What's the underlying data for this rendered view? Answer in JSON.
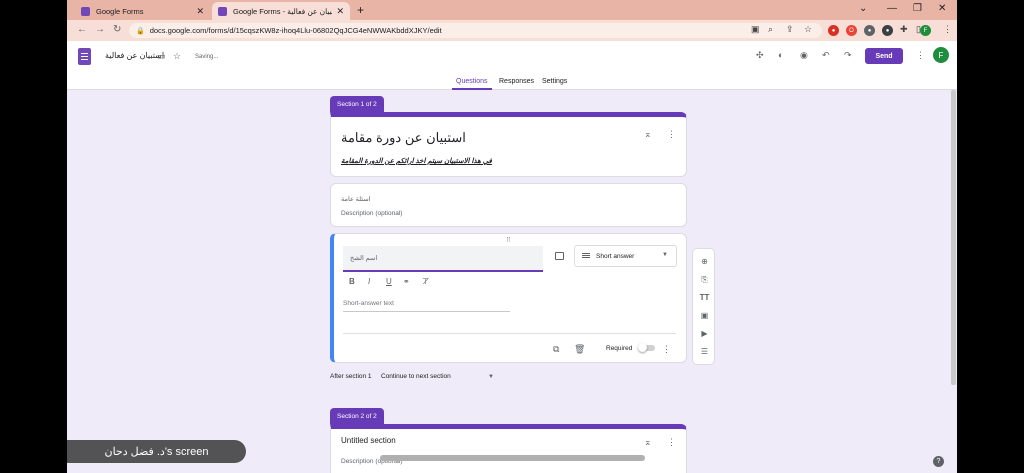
{
  "browser": {
    "tabs": [
      {
        "label": "Google Forms"
      },
      {
        "label": "Google Forms - استبيان عن فعالية"
      }
    ],
    "new_tab": "+",
    "minimize": "⌄",
    "url": "docs.google.com/forms/d/15cqszKW8z-ihoq4Llu-06802QqJCG4eNWWAKbddXJKY/edit",
    "profile_initial": "F"
  },
  "header": {
    "form_title": "استبيان عن فعالية",
    "status": "Saving...",
    "send_label": "Send",
    "avatar_initial": "F",
    "tabs": [
      "Questions",
      "Responses",
      "Settings"
    ]
  },
  "section1": {
    "tag": "Section 1 of 2",
    "title": "استبيان عن دورة مقامة",
    "description": "في هذا الاستبيان سيتم اخذ ارائكم عن الدورة المقامة"
  },
  "group_card": {
    "title": "اسئلة عامة",
    "description_placeholder": "Description (optional)"
  },
  "question": {
    "text": "اسم الشخ",
    "type": "Short answer",
    "answer_placeholder": "Short-answer text",
    "required_label": "Required",
    "format": [
      "B",
      "I",
      "U"
    ]
  },
  "after_section": {
    "label": "After section 1",
    "value": "Continue to next section"
  },
  "section2": {
    "tag": "Section 2 of 2",
    "title": "Untitled section",
    "description_placeholder": "Description (optional)"
  },
  "help": "?",
  "watermark": "د. فضل دحان's screen"
}
